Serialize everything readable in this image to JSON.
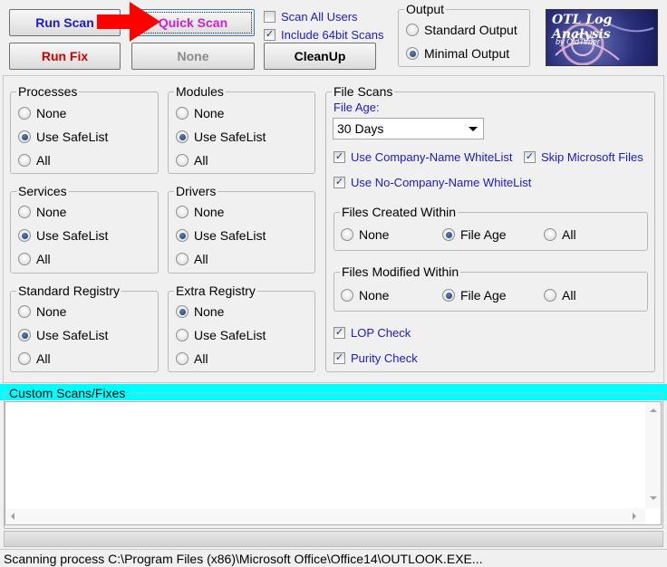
{
  "toolbar": {
    "run_scan": "Run Scan",
    "quick_scan": "Quick Scan",
    "run_fix": "Run Fix",
    "none": "None",
    "cleanup": "CleanUp",
    "scan_all_users": "Scan All Users",
    "include_64bit": "Include 64bit Scans"
  },
  "output": {
    "title": "Output",
    "standard": "Standard Output",
    "minimal": "Minimal Output"
  },
  "logo": {
    "title": "OTL Log Analysis",
    "byline": "by OldTimer"
  },
  "groups": {
    "processes": "Processes",
    "modules": "Modules",
    "services": "Services",
    "drivers": "Drivers",
    "standard_registry": "Standard Registry",
    "extra_registry": "Extra Registry"
  },
  "options": {
    "none": "None",
    "safelist": "Use SafeList",
    "all": "All"
  },
  "file_scans": {
    "title": "File Scans",
    "file_age_label": "File Age:",
    "file_age_value": "30 Days",
    "company_whitelist": "Use Company-Name WhiteList",
    "skip_ms": "Skip Microsoft Files",
    "nocompany_whitelist": "Use No-Company-Name WhiteList",
    "created_within": "Files Created Within",
    "modified_within": "Files Modified Within",
    "opt_none": "None",
    "opt_file_age": "File Age",
    "opt_all": "All",
    "lop_check": "LOP Check",
    "purity_check": "Purity Check"
  },
  "custom": {
    "title": "Custom Scans/Fixes"
  },
  "status": {
    "text": "Scanning process C:\\Program Files (x86)\\Microsoft Office\\Office14\\OUTLOOK.EXE..."
  },
  "colors": {
    "accent_blue": "#1a1ad2",
    "red": "#d00000",
    "magenta": "#d21cd2",
    "cyan_bar": "#00ffff",
    "arrow_red": "#ff0000"
  }
}
